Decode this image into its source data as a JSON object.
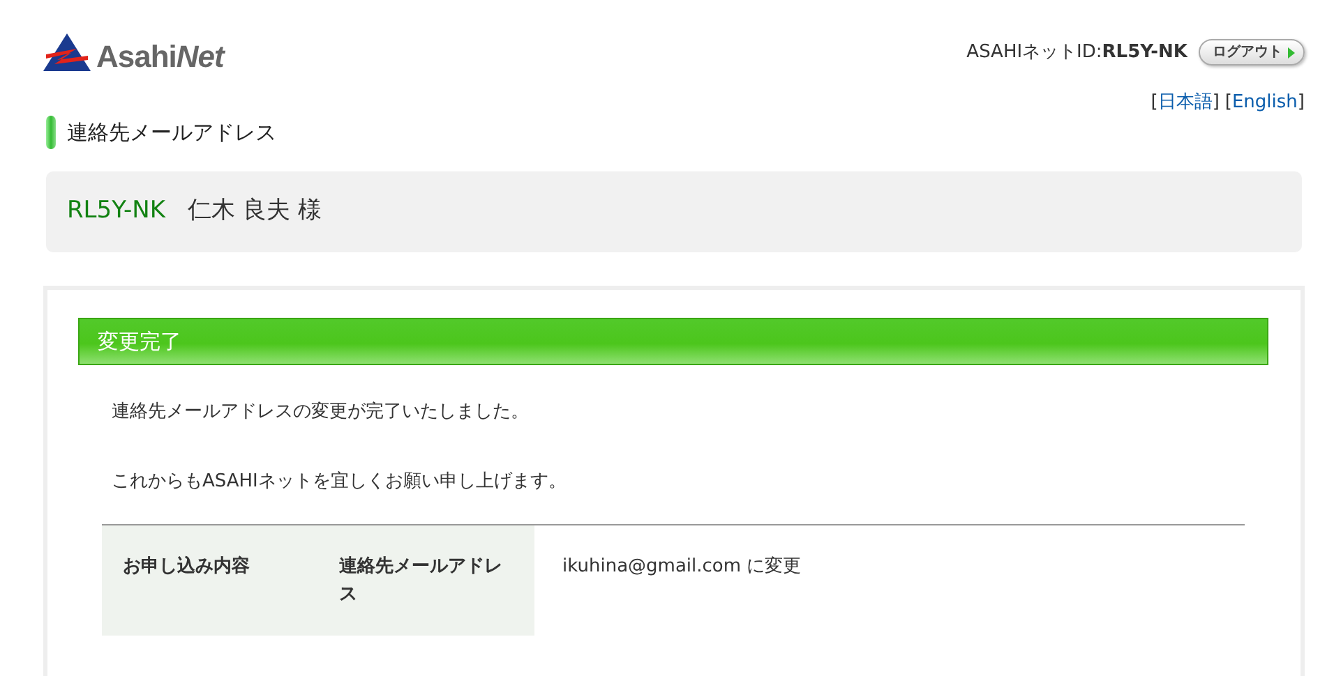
{
  "logo": {
    "main": "Asahi",
    "accent": "Net"
  },
  "account": {
    "label": "ASAHIネットID:",
    "id": "RL5Y-NK",
    "logout": "ログアウト"
  },
  "languages": [
    {
      "open": "[",
      "label": "日本語",
      "close": "]"
    },
    {
      "open": "[",
      "label": "English",
      "close": "]"
    }
  ],
  "page_title": "連絡先メールアドレス",
  "user": {
    "id": "RL5Y-NK",
    "name": "仁木 良夫 様"
  },
  "panel": {
    "heading": "変更完了",
    "messages": [
      "連絡先メールアドレスの変更が完了いたしました。",
      "これからもASAHIネットを宜しくお願い申し上げます。"
    ],
    "table": [
      {
        "heading": "お申し込み内容",
        "item": "連絡先メールアドレス",
        "value": "ikuhina@gmail.com に変更"
      }
    ]
  }
}
